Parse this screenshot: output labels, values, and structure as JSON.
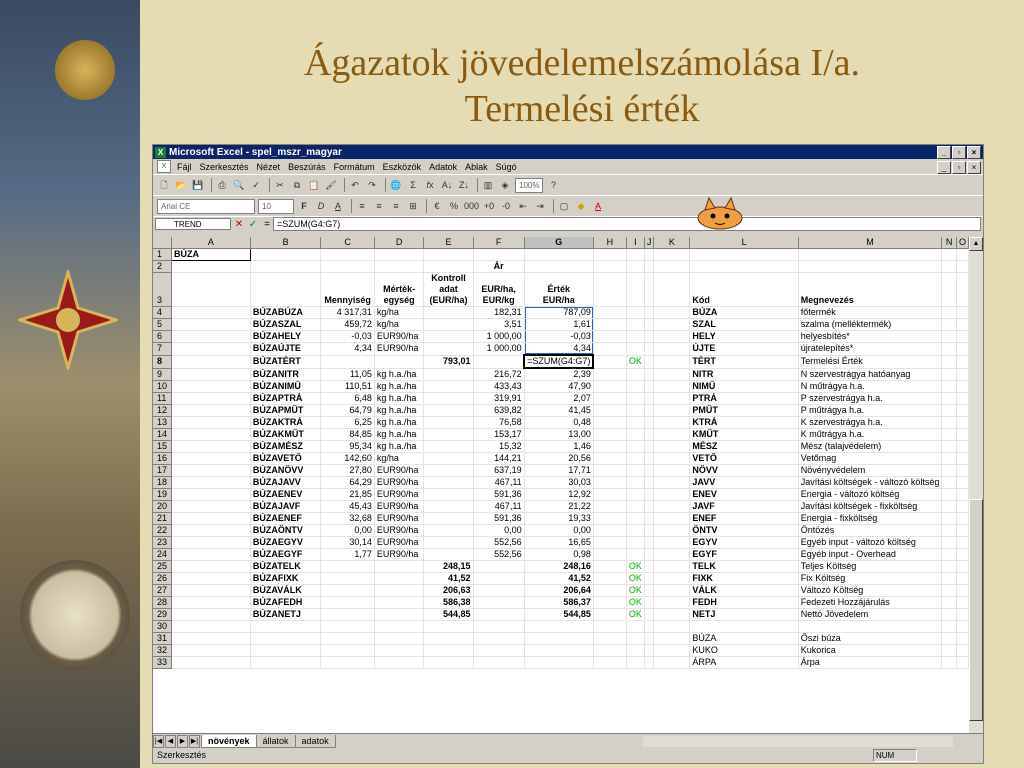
{
  "slide": {
    "title_line1": "Ágazatok jövedelemelszámolása I/a.",
    "title_line2": "Termelési érték"
  },
  "window": {
    "title": "Microsoft Excel - spel_mszr_magyar",
    "min": "_",
    "max": "▫",
    "close": "×"
  },
  "menu": [
    "Fájl",
    "Szerkesztés",
    "Nézet",
    "Beszúrás",
    "Formátum",
    "Eszközök",
    "Adatok",
    "Ablak",
    "Súgó"
  ],
  "toolbar": {
    "zoom": "100%",
    "font": "Arial CE",
    "size": "10"
  },
  "formula_bar": {
    "name_box": "TREND",
    "formula": "=SZUM(G4:G7)"
  },
  "columns": [
    "A",
    "B",
    "C",
    "D",
    "E",
    "F",
    "G",
    "H",
    "I",
    "J",
    "K",
    "L",
    "M",
    "N",
    "O"
  ],
  "header_row2": {
    "F": "Ár"
  },
  "header_row3": {
    "C": "Mennyiség",
    "D": "Mérték-\negység",
    "E": "Kontroll\nadat\n(EUR/ha)",
    "F": "EUR/ha,\nEUR/kg",
    "G": "Érték\nEUR/ha",
    "L": "Kód",
    "M": "Megnevezés"
  },
  "row1_A": "BÚZA",
  "rows": [
    {
      "n": "4",
      "B": "BÚZABÚZA",
      "C": "4 317,31",
      "D": "kg/ha",
      "E": "",
      "F": "182,31",
      "G": "787,09",
      "I": "",
      "L": "BÚZA",
      "M": "főtermék"
    },
    {
      "n": "5",
      "B": "BÚZASZAL",
      "C": "459,72",
      "D": "kg/ha",
      "E": "",
      "F": "3,51",
      "G": "1,61",
      "I": "",
      "L": "SZAL",
      "M": "szalma (melléktermék)"
    },
    {
      "n": "6",
      "B": "BÚZAHELY",
      "C": "-0,03",
      "D": "EUR90/ha",
      "E": "",
      "F": "1 000,00",
      "G": "-0,03",
      "I": "",
      "L": "HELY",
      "M": "helyesbítés*"
    },
    {
      "n": "7",
      "B": "BÚZAÚJTE",
      "C": "4,34",
      "D": "EUR90/ha",
      "E": "",
      "F": "1 000,00",
      "G": "4,34",
      "I": "",
      "L": "ÚJTE",
      "M": "újratelepítés*"
    },
    {
      "n": "8",
      "B": "BÚZATÉRT",
      "C": "",
      "D": "",
      "E": "793,01",
      "F": "",
      "G": "=SZUM(G4:G7)",
      "I": "OK",
      "L": "TÉRT",
      "M": "Termelési Érték"
    },
    {
      "n": "9",
      "B": "BÚZANITR",
      "C": "11,05",
      "D": "kg h.a./ha",
      "E": "",
      "F": "216,72",
      "G": "2,39",
      "I": "",
      "L": "NITR",
      "M": "N szervestrágya hatóanyag"
    },
    {
      "n": "10",
      "B": "BÚZANIMŰ",
      "C": "110,51",
      "D": "kg h.a./ha",
      "E": "",
      "F": "433,43",
      "G": "47,90",
      "I": "",
      "L": "NIMŰ",
      "M": "N műtrágya h.a."
    },
    {
      "n": "11",
      "B": "BÚZAPTRÁ",
      "C": "6,48",
      "D": "kg h.a./ha",
      "E": "",
      "F": "319,91",
      "G": "2,07",
      "I": "",
      "L": "PTRÁ",
      "M": "P szervestrágya h.a."
    },
    {
      "n": "12",
      "B": "BÚZAPMŰT",
      "C": "64,79",
      "D": "kg h.a./ha",
      "E": "",
      "F": "639,82",
      "G": "41,45",
      "I": "",
      "L": "PMŰT",
      "M": "P műtrágya h.a."
    },
    {
      "n": "13",
      "B": "BÚZAKTRÁ",
      "C": "6,25",
      "D": "kg h.a./ha",
      "E": "",
      "F": "76,58",
      "G": "0,48",
      "I": "",
      "L": "KTRÁ",
      "M": "K szervestrágya h.a."
    },
    {
      "n": "14",
      "B": "BÚZAKMŰT",
      "C": "84,85",
      "D": "kg h.a./ha",
      "E": "",
      "F": "153,17",
      "G": "13,00",
      "I": "",
      "L": "KMŰT",
      "M": "K műtrágya h.a."
    },
    {
      "n": "15",
      "B": "BÚZAMÉSZ",
      "C": "95,34",
      "D": "kg h.a./ha",
      "E": "",
      "F": "15,32",
      "G": "1,46",
      "I": "",
      "L": "MÉSZ",
      "M": "Mész (talajvédelem)"
    },
    {
      "n": "16",
      "B": "BÚZAVETŐ",
      "C": "142,60",
      "D": "kg/ha",
      "E": "",
      "F": "144,21",
      "G": "20,56",
      "I": "",
      "L": "VETŐ",
      "M": "Vetőmag"
    },
    {
      "n": "17",
      "B": "BÚZANÖVV",
      "C": "27,80",
      "D": "EUR90/ha",
      "E": "",
      "F": "637,19",
      "G": "17,71",
      "I": "",
      "L": "NÖVV",
      "M": "Növényvédelem"
    },
    {
      "n": "18",
      "B": "BÚZAJAVV",
      "C": "64,29",
      "D": "EUR90/ha",
      "E": "",
      "F": "467,11",
      "G": "30,03",
      "I": "",
      "L": "JAVV",
      "M": "Javítási költségek - változó költség"
    },
    {
      "n": "19",
      "B": "BÚZAENEV",
      "C": "21,85",
      "D": "EUR90/ha",
      "E": "",
      "F": "591,36",
      "G": "12,92",
      "I": "",
      "L": "ENEV",
      "M": "Energia - változó költség"
    },
    {
      "n": "20",
      "B": "BÚZAJAVF",
      "C": "45,43",
      "D": "EUR90/ha",
      "E": "",
      "F": "467,11",
      "G": "21,22",
      "I": "",
      "L": "JAVF",
      "M": "Javítási költségek - fixköltség"
    },
    {
      "n": "21",
      "B": "BÚZAENEF",
      "C": "32,68",
      "D": "EUR90/ha",
      "E": "",
      "F": "591,36",
      "G": "19,33",
      "I": "",
      "L": "ENEF",
      "M": "Energia - fixköltség"
    },
    {
      "n": "22",
      "B": "BÚZAÖNTV",
      "C": "0,00",
      "D": "EUR90/ha",
      "E": "",
      "F": "0,00",
      "G": "0,00",
      "I": "",
      "L": "ÖNTV",
      "M": "Öntözés"
    },
    {
      "n": "23",
      "B": "BÚZAEGYV",
      "C": "30,14",
      "D": "EUR90/ha",
      "E": "",
      "F": "552,56",
      "G": "16,65",
      "I": "",
      "L": "EGYV",
      "M": "Egyéb input - változó költség"
    },
    {
      "n": "24",
      "B": "BÚZAEGYF",
      "C": "1,77",
      "D": "EUR90/ha",
      "E": "",
      "F": "552,56",
      "G": "0,98",
      "I": "",
      "L": "EGYF",
      "M": "Egyéb input - Overhead"
    },
    {
      "n": "25",
      "B": "BÚZATELK",
      "C": "",
      "D": "",
      "E": "248,15",
      "F": "",
      "G": "248,16",
      "I": "OK",
      "L": "TELK",
      "M": "Teljes Költség"
    },
    {
      "n": "26",
      "B": "BÚZAFIXK",
      "C": "",
      "D": "",
      "E": "41,52",
      "F": "",
      "G": "41,52",
      "I": "OK",
      "L": "FIXK",
      "M": "Fix Költség"
    },
    {
      "n": "27",
      "B": "BÚZAVÁLK",
      "C": "",
      "D": "",
      "E": "206,63",
      "F": "",
      "G": "206,64",
      "I": "OK",
      "L": "VÁLK",
      "M": "Változó Költség"
    },
    {
      "n": "28",
      "B": "BÚZAFEDH",
      "C": "",
      "D": "",
      "E": "586,38",
      "F": "",
      "G": "586,37",
      "I": "OK",
      "L": "FEDH",
      "M": "Fedezeti Hozzájárulás"
    },
    {
      "n": "29",
      "B": "BÚZANETJ",
      "C": "",
      "D": "",
      "E": "544,85",
      "F": "",
      "G": "544,85",
      "I": "OK",
      "L": "NETJ",
      "M": "Nettó Jövedelem"
    },
    {
      "n": "30",
      "B": "",
      "C": "",
      "D": "",
      "E": "",
      "F": "",
      "G": "",
      "I": "",
      "L": "",
      "M": ""
    },
    {
      "n": "31",
      "B": "",
      "C": "",
      "D": "",
      "E": "",
      "F": "",
      "G": "",
      "I": "",
      "L": "BÚZA",
      "M": "Őszi búza"
    },
    {
      "n": "32",
      "B": "",
      "C": "",
      "D": "",
      "E": "",
      "F": "",
      "G": "",
      "I": "",
      "L": "KUKO",
      "M": "Kukorica"
    },
    {
      "n": "33",
      "B": "",
      "C": "",
      "D": "",
      "E": "",
      "F": "",
      "G": "",
      "I": "",
      "L": "ÁRPA",
      "M": "Árpa"
    }
  ],
  "sheet_tabs": [
    "növények",
    "állatok",
    "adatok"
  ],
  "status": {
    "mode": "Szerkesztés",
    "num": "NUM"
  },
  "colors": {
    "title": "#8a5a10",
    "ok": "#00b000",
    "titlebar": "#0a246a"
  }
}
